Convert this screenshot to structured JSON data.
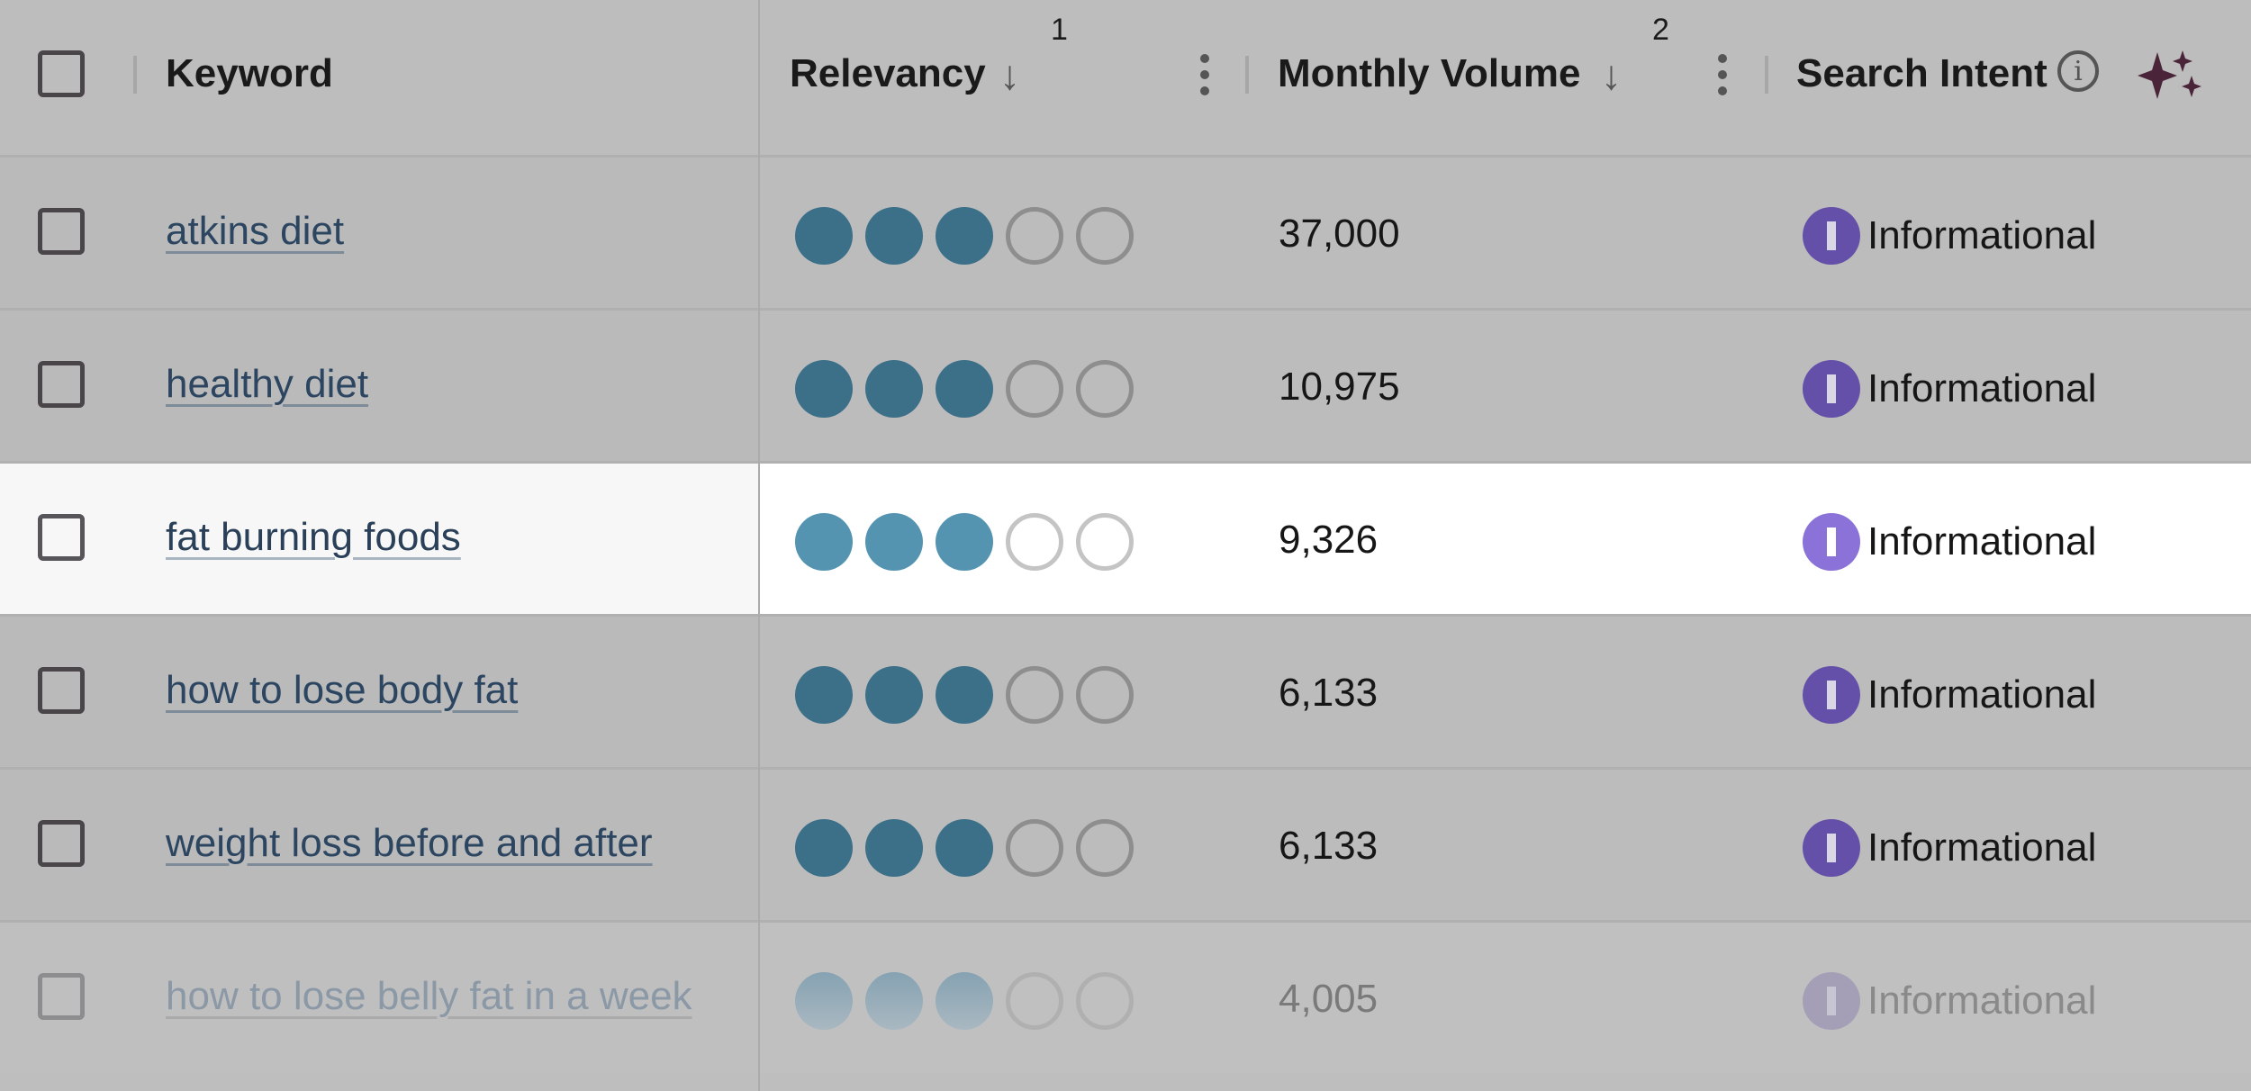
{
  "header": {
    "keyword_label": "Keyword",
    "relevancy_label": "Relevancy",
    "relevancy_sort_order": "1",
    "volume_label": "Monthly Volume",
    "volume_sort_order": "2",
    "intent_label": "Search Intent",
    "info_icon": "i",
    "sort_icon": "↓"
  },
  "rows": [
    {
      "keyword": "atkins diet",
      "relevancy": 3,
      "relevancy_max": 5,
      "volume": "37,000",
      "intent": "Informational",
      "intent_badge": "I"
    },
    {
      "keyword": "healthy diet",
      "relevancy": 3,
      "relevancy_max": 5,
      "volume": "10,975",
      "intent": "Informational",
      "intent_badge": "I"
    },
    {
      "keyword": "fat burning foods",
      "relevancy": 3,
      "relevancy_max": 5,
      "volume": "9,326",
      "intent": "Informational",
      "intent_badge": "I"
    },
    {
      "keyword": "how to lose body fat",
      "relevancy": 3,
      "relevancy_max": 5,
      "volume": "6,133",
      "intent": "Informational",
      "intent_badge": "I"
    },
    {
      "keyword": "weight loss before and after",
      "relevancy": 3,
      "relevancy_max": 5,
      "volume": "6,133",
      "intent": "Informational",
      "intent_badge": "I"
    },
    {
      "keyword": "how to lose belly fat in a week",
      "relevancy": 3,
      "relevancy_max": 5,
      "volume": "4,005",
      "intent": "Informational",
      "intent_badge": "I"
    }
  ],
  "colors": {
    "relevancy_filled": "#3c6f88",
    "relevancy_filled_highlight": "#5494b1",
    "intent_informational": "#6550a9",
    "intent_informational_highlight": "#8a72d8",
    "sparkle_accent": "#4a2438"
  }
}
